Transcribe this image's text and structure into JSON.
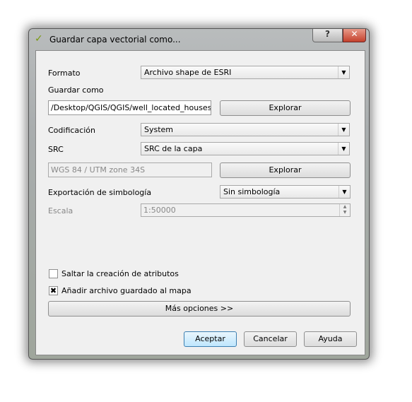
{
  "window": {
    "title": "Guardar capa vectorial como...",
    "help": "?",
    "close": "✕",
    "app_icon": "qgis-icon"
  },
  "form": {
    "formato_label": "Formato",
    "formato_value": "Archivo shape de ESRI",
    "guardar_label": "Guardar como",
    "guardar_value": "/Desktop/QGIS/QGIS/well_located_houses.shp",
    "explorar1": "Explorar",
    "codificacion_label": "Codificación",
    "codificacion_value": "System",
    "src_label": "SRC",
    "src_value": "SRC de la capa",
    "crs_value": "WGS 84 / UTM zone 34S",
    "explorar2": "Explorar",
    "simbologia_label": "Exportación de simbología",
    "simbologia_value": "Sin simbología",
    "escala_label": "Escala",
    "escala_value": "1:50000",
    "skip_attrs_label": "Saltar la creación de atributos",
    "skip_attrs_checked": false,
    "add_map_label": "Añadir archivo guardado al mapa",
    "add_map_checked": true,
    "more_options": "Más opciones >>"
  },
  "buttons": {
    "accept": "Aceptar",
    "cancel": "Cancelar",
    "help": "Ayuda"
  }
}
